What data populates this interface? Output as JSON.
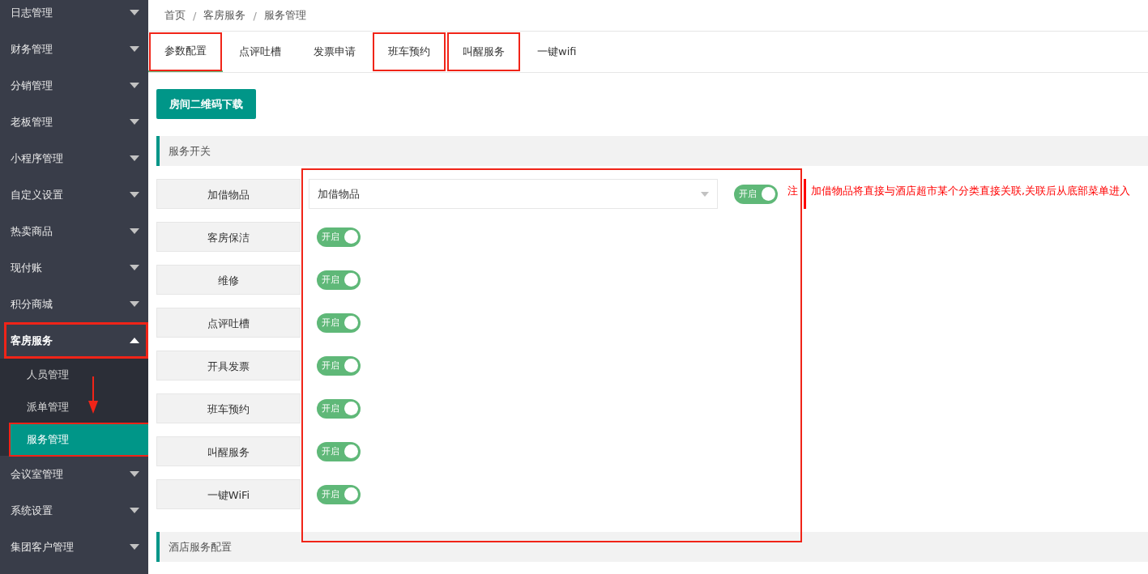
{
  "sidebar": {
    "items": [
      {
        "label": "日志管理",
        "expanded": false,
        "highlighted": false
      },
      {
        "label": "财务管理",
        "expanded": false,
        "highlighted": false
      },
      {
        "label": "分销管理",
        "expanded": false,
        "highlighted": false
      },
      {
        "label": "老板管理",
        "expanded": false,
        "highlighted": false
      },
      {
        "label": "小程序管理",
        "expanded": false,
        "highlighted": false
      },
      {
        "label": "自定义设置",
        "expanded": false,
        "highlighted": false
      },
      {
        "label": "热卖商品",
        "expanded": false,
        "highlighted": false
      },
      {
        "label": "现付账",
        "expanded": false,
        "highlighted": false
      },
      {
        "label": "积分商城",
        "expanded": false,
        "highlighted": false
      },
      {
        "label": "客房服务",
        "expanded": true,
        "highlighted": true,
        "children": [
          {
            "label": "人员管理",
            "selected": false,
            "highlighted": false
          },
          {
            "label": "派单管理",
            "selected": false,
            "highlighted": false,
            "arrow_below": true
          },
          {
            "label": "服务管理",
            "selected": true,
            "highlighted": true
          }
        ]
      },
      {
        "label": "会议室管理",
        "expanded": false,
        "highlighted": false
      },
      {
        "label": "系统设置",
        "expanded": false,
        "highlighted": false
      },
      {
        "label": "集团客户管理",
        "expanded": false,
        "highlighted": false
      }
    ]
  },
  "breadcrumb": [
    "首页",
    "/",
    "客房服务",
    "/",
    "服务管理"
  ],
  "tabs": [
    {
      "label": "参数配置",
      "selected": true,
      "highlighted": true
    },
    {
      "label": "点评吐槽",
      "selected": false,
      "highlighted": false
    },
    {
      "label": "发票申请",
      "selected": false,
      "highlighted": false
    },
    {
      "label": "班车预约",
      "selected": false,
      "highlighted": true
    },
    {
      "label": "叫醒服务",
      "selected": false,
      "highlighted": true
    },
    {
      "label": "一键wifi",
      "selected": false,
      "highlighted": false
    }
  ],
  "download_button": "房间二维码下载",
  "service_switches": {
    "title": "服务开关",
    "highlighted": true,
    "rows": [
      {
        "label": "加借物品",
        "kind": "select",
        "select_value": "加借物品",
        "toggle": {
          "text": "开启",
          "on": true
        },
        "note_mark": "注",
        "note": "加借物品将直接与酒店超市某个分类直接关联,关联后从底部菜单进入"
      },
      {
        "label": "客房保洁",
        "kind": "toggle",
        "toggle": {
          "text": "开启",
          "on": true
        }
      },
      {
        "label": "维修",
        "kind": "toggle",
        "toggle": {
          "text": "开启",
          "on": true
        }
      },
      {
        "label": "点评吐槽",
        "kind": "toggle",
        "toggle": {
          "text": "开启",
          "on": true
        }
      },
      {
        "label": "开具发票",
        "kind": "toggle",
        "toggle": {
          "text": "开启",
          "on": true
        }
      },
      {
        "label": "班车预约",
        "kind": "toggle",
        "toggle": {
          "text": "开启",
          "on": true
        }
      },
      {
        "label": "叫醒服务",
        "kind": "toggle",
        "toggle": {
          "text": "开启",
          "on": true
        }
      },
      {
        "label": "一键WiFi",
        "kind": "toggle",
        "toggle": {
          "text": "开启",
          "on": true
        }
      }
    ]
  },
  "hotel_service_config": {
    "title": "酒店服务配置"
  }
}
